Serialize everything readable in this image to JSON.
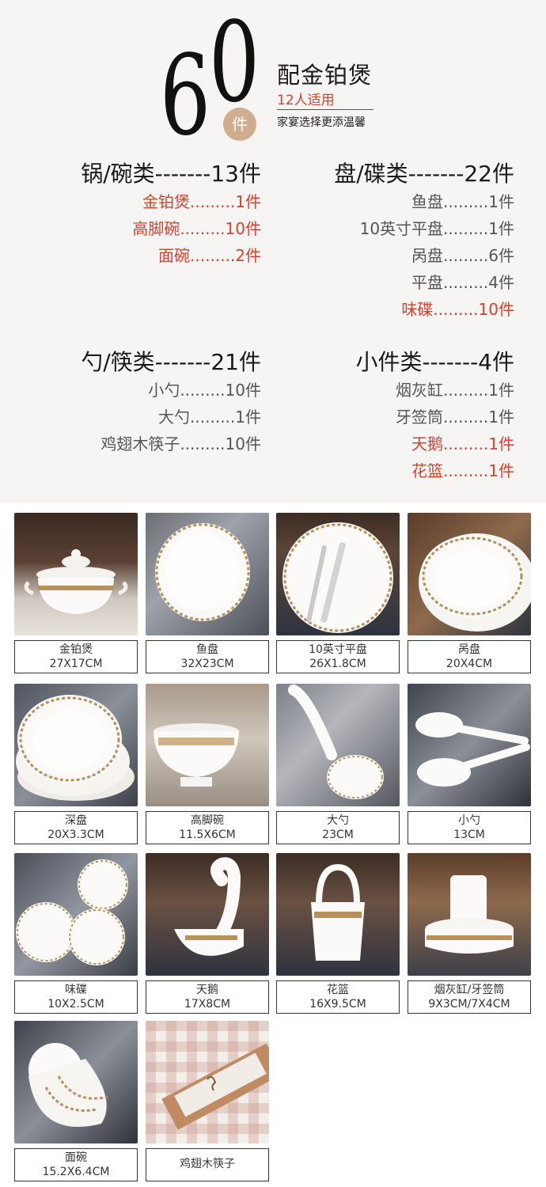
{
  "hero": {
    "digit1": "6",
    "digit2": "0",
    "badge": "件",
    "title": "配金铂煲",
    "subtitle": "12人适用",
    "tagline": "家宴选择更添温馨"
  },
  "categories": [
    {
      "heading": "锅/碗类-------13件",
      "items": [
        {
          "text": "金铂煲.........1件",
          "highlight": true
        },
        {
          "text": "高脚碗.........10件",
          "highlight": true
        },
        {
          "text": "面碗.........2件",
          "highlight": true
        }
      ]
    },
    {
      "heading": "盘/碟类-------22件",
      "items": [
        {
          "text": "鱼盘.........1件",
          "highlight": false
        },
        {
          "text": "10英寸平盘.........1件",
          "highlight": false
        },
        {
          "text": "呙盘.........6件",
          "highlight": false
        },
        {
          "text": "平盘.........4件",
          "highlight": false
        },
        {
          "text": "味碟.........10件",
          "highlight": true
        }
      ]
    },
    {
      "heading": "勺/筷类-------21件",
      "items": [
        {
          "text": "小勺.........10件",
          "highlight": false
        },
        {
          "text": "大勺.........1件",
          "highlight": false
        },
        {
          "text": "鸡翅木筷子.........10件",
          "highlight": false
        }
      ]
    },
    {
      "heading": "小件类-------4件",
      "items": [
        {
          "text": "烟灰缸.........1件",
          "highlight": false
        },
        {
          "text": "牙签筒.........1件",
          "highlight": false
        },
        {
          "text": "天鹅.........1件",
          "highlight": true
        },
        {
          "text": "花篮.........1件",
          "highlight": true
        }
      ]
    }
  ],
  "products": [
    {
      "name": "金铂煲",
      "size": "27X17CM"
    },
    {
      "name": "鱼盘",
      "size": "32X23CM"
    },
    {
      "name": "10英寸平盘",
      "size": "26X1.8CM"
    },
    {
      "name": "呙盘",
      "size": "20X4CM"
    },
    {
      "name": "深盘",
      "size": "20X3.3CM"
    },
    {
      "name": "高脚碗",
      "size": "11.5X6CM"
    },
    {
      "name": "大勺",
      "size": "23CM"
    },
    {
      "name": "小勺",
      "size": "13CM"
    },
    {
      "name": "味碟",
      "size": "10X2.5CM"
    },
    {
      "name": "天鹅",
      "size": "17X8CM"
    },
    {
      "name": "花篮",
      "size": "16X9.5CM"
    },
    {
      "name": "烟灰缸/牙签筒",
      "size": "9X3CM/7X4CM"
    },
    {
      "name": "面碗",
      "size": "15.2X6.4CM"
    },
    {
      "name": "鸡翅木筷子",
      "size": ""
    }
  ],
  "colors": {
    "highlight": "#d4422e",
    "badge": "#cfae8f",
    "panel": "#f6f5f4",
    "gold_trim": "#b8905a"
  }
}
